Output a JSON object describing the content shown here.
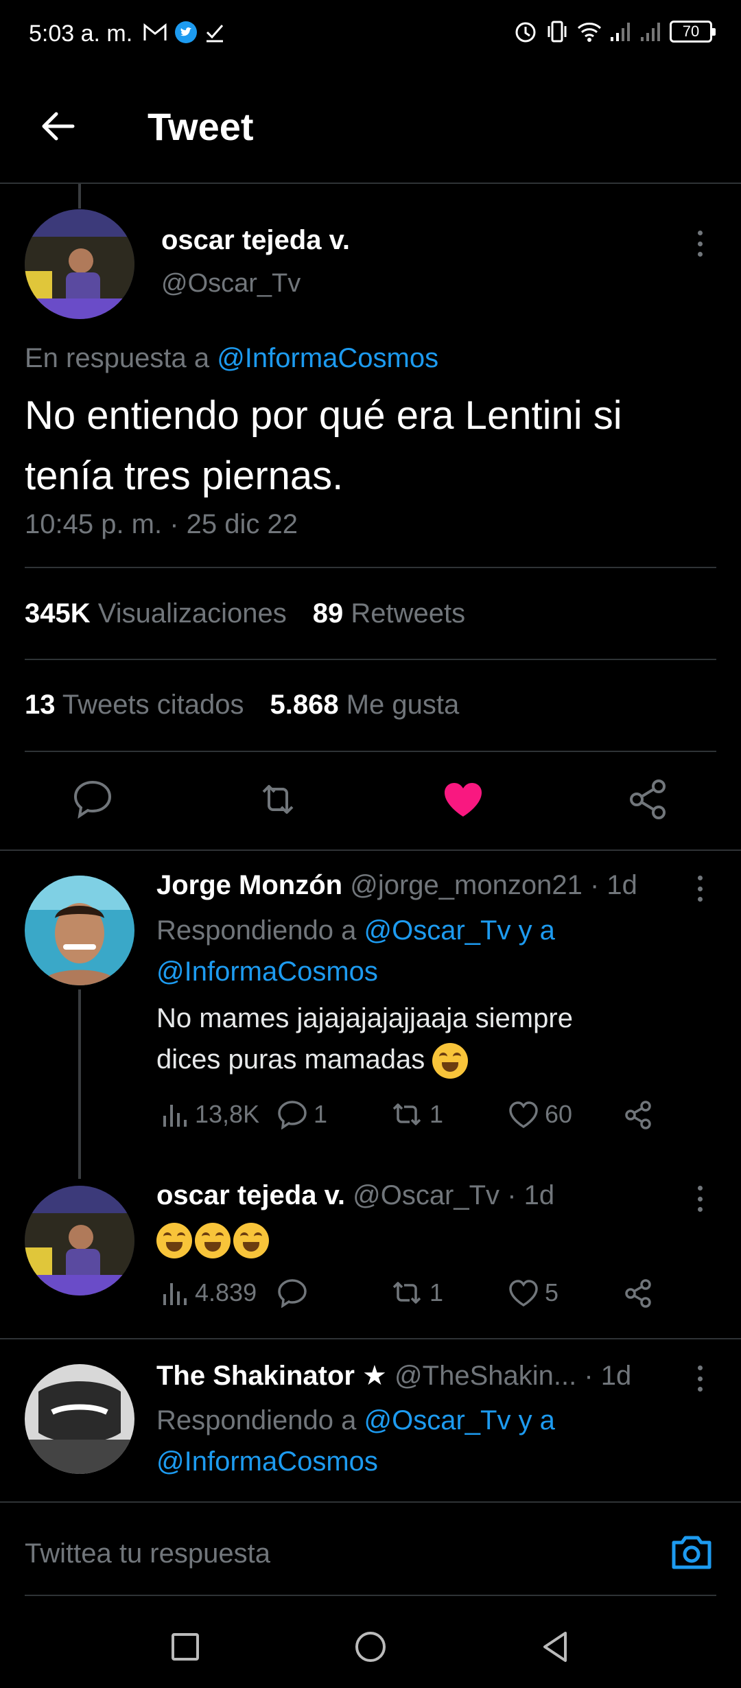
{
  "status_bar": {
    "time": "5:03 a. m.",
    "battery": "70",
    "icons_left": [
      "gmail-icon",
      "twitter-icon",
      "download-done-icon"
    ],
    "icons_right": [
      "alarm-icon",
      "vibrate-icon",
      "wifi-icon",
      "signal-icon",
      "signal-icon",
      "battery-icon"
    ]
  },
  "header": {
    "title": "Tweet",
    "back_icon": "arrow-left-icon"
  },
  "main_tweet": {
    "author_name": "oscar tejeda v.",
    "author_handle": "@Oscar_Tv",
    "reply_prefix": "En respuesta a",
    "reply_to": "@InformaCosmos",
    "text": "No entiendo por qué era Lentini si tenía tres piernas.",
    "timestamp": "10:45 p. m. · 25 dic 22",
    "views_count": "345K",
    "views_label": "Visualizaciones",
    "retweets_count": "89",
    "retweets_label": "Retweets",
    "quotes_count": "13",
    "quotes_label": "Tweets citados",
    "likes_count": "5.868",
    "likes_label": "Me gusta",
    "liked": true
  },
  "replies": [
    {
      "author_name": "Jorge Monzón",
      "author_handle": "@jorge_monzon21",
      "age": "· 1d",
      "replying_prefix": "Respondiendo a",
      "replying_to_1": "@Oscar_Tv y a",
      "replying_to_2": "@InformaCosmos",
      "text_line1": "No mames jajajajajajjaaja siempre",
      "text_line2": "dices puras mamadas",
      "views": "13,8K",
      "replies": "1",
      "retweets": "1",
      "likes": "60"
    },
    {
      "author_name": "oscar tejeda v.",
      "author_handle": "@Oscar_Tv",
      "age": "· 1d",
      "views": "4.839",
      "replies": "",
      "retweets": "1",
      "likes": "5"
    },
    {
      "author_name": "The Shakinator ★",
      "author_handle": "@TheShakin...",
      "age": "· 1d",
      "replying_prefix": "Respondiendo a",
      "replying_to_1": "@Oscar_Tv y a",
      "replying_to_2": "@InformaCosmos"
    }
  ],
  "compose": {
    "placeholder": "Twittea tu respuesta",
    "camera_icon": "camera-icon"
  },
  "nav": [
    "square-recents-icon",
    "circle-home-icon",
    "triangle-back-icon"
  ],
  "colors": {
    "accent": "#1d9bf0",
    "like": "#f91880",
    "muted": "#71767b",
    "background": "#000000"
  }
}
